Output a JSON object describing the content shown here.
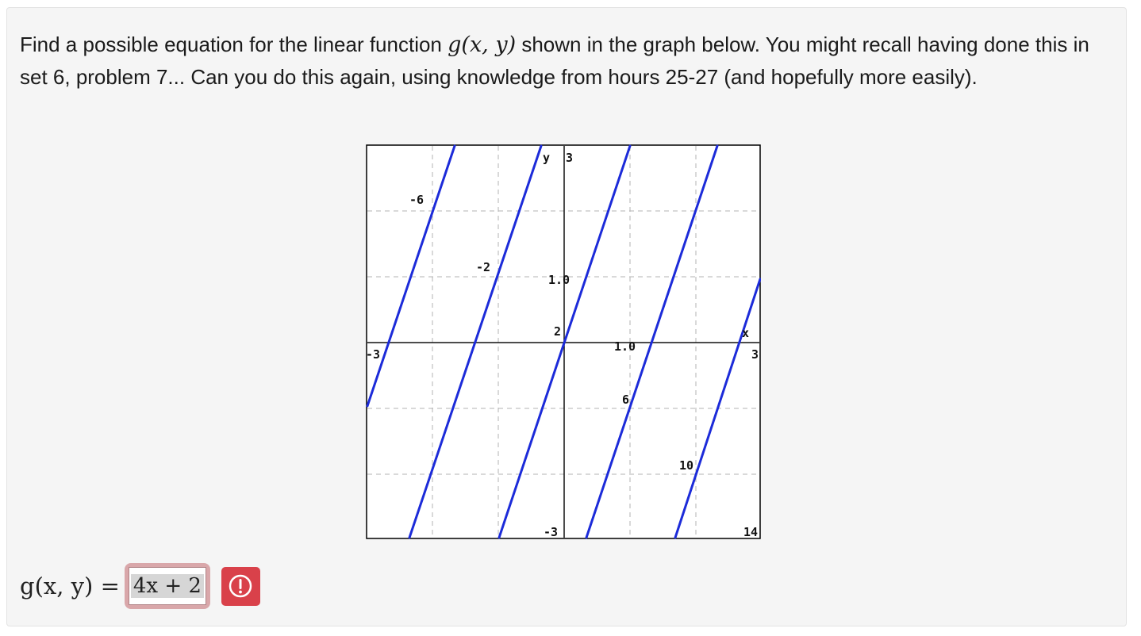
{
  "problem": {
    "text_before": "Find a possible equation for the linear function ",
    "function_notation": "g(x, y)",
    "text_after": " shown in the graph below. You might recall having done this in set 6, problem 7... Can you do this again, using knowledge from hours 25-27 (and hopefully more easily)."
  },
  "graph": {
    "axis_label_y": "y",
    "axis_label_x": "x",
    "y_top_label": "3",
    "y_bottom_label": "-3",
    "x_left_label": "-3",
    "x_right_label": "3",
    "contour_labels": [
      "-6",
      "-2",
      "1.0",
      "2",
      "1.0",
      "6",
      "10",
      "14"
    ]
  },
  "answer": {
    "lhs": "g(x, y) =",
    "value": "4x + 2",
    "feedback_icon": "exclamation-circle-icon",
    "status_color": "#d9414a"
  },
  "chart_data": {
    "type": "line",
    "title": "",
    "xlabel": "x",
    "ylabel": "y",
    "xlim": [
      -3,
      3
    ],
    "ylim": [
      -3,
      3
    ],
    "grid": true,
    "contours": [
      {
        "label": "-6",
        "points": [
          [
            -3,
            -1
          ],
          [
            -1.4,
            3
          ]
        ]
      },
      {
        "label": "-2",
        "points": [
          [
            -3,
            -4.9
          ],
          [
            -0.2,
            3
          ]
        ]
      },
      {
        "label": "2",
        "points": [
          [
            -1,
            -3
          ],
          [
            1,
            3
          ]
        ]
      },
      {
        "label": "6",
        "points": [
          [
            0.2,
            -3
          ],
          [
            2.4,
            3
          ]
        ]
      },
      {
        "label": "10",
        "points": [
          [
            1.6,
            -3
          ],
          [
            3,
            1
          ]
        ]
      },
      {
        "label": "14",
        "points": [
          [
            3,
            -3
          ]
        ]
      }
    ]
  }
}
